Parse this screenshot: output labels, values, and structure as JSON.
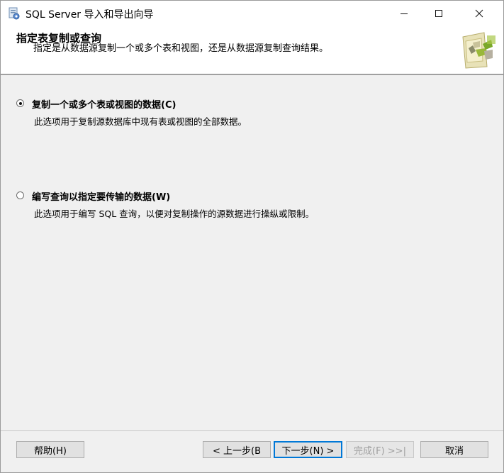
{
  "window": {
    "title": "SQL Server 导入和导出向导"
  },
  "header": {
    "title": "指定表复制或查询",
    "subtitle": "指定是从数据源复制一个或多个表和视图，还是从数据源复制查询结果。"
  },
  "options": [
    {
      "label": "复制一个或多个表或视图的数据(C)",
      "description": "此选项用于复制源数据库中现有表或视图的全部数据。",
      "selected": true
    },
    {
      "label": "编写查询以指定要传输的数据(W)",
      "description": "此选项用于编写 SQL 查询，以便对复制操作的源数据进行操纵或限制。",
      "selected": false
    }
  ],
  "buttons": {
    "help": "帮助(H)",
    "back": "< 上一步(B",
    "next": "下一步(N) >",
    "finish": "完成(F) >>|",
    "cancel": "取消"
  },
  "colors": {
    "focus_border": "#0078d7",
    "header_bg": "#ffffff",
    "body_bg": "#f0f0f0"
  },
  "icons": {
    "app": "wizard-app-icon",
    "header": "table-copy-graphic-icon",
    "minimize": "minimize-icon",
    "maximize": "maximize-icon",
    "close": "close-icon"
  }
}
